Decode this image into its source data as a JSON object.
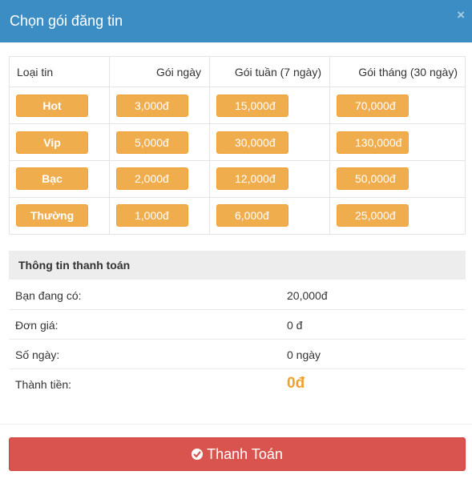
{
  "dialog": {
    "title": "Chọn gói đăng tin",
    "close_icon": "×"
  },
  "pricing": {
    "headers": [
      "Loại tin",
      "Gói ngày",
      "Gói tuần (7 ngày)",
      "Gói tháng (30 ngày)"
    ],
    "rows": [
      {
        "type": "Hot",
        "day": "3,000đ",
        "week": "15,000đ",
        "month": "70,000đ"
      },
      {
        "type": "Vip",
        "day": "5,000đ",
        "week": "30,000đ",
        "month": "130,000đ"
      },
      {
        "type": "Bạc",
        "day": "2,000đ",
        "week": "12,000đ",
        "month": "50,000đ"
      },
      {
        "type": "Thường",
        "day": "1,000đ",
        "week": "6,000đ",
        "month": "25,000đ"
      }
    ]
  },
  "payment_info": {
    "title": "Thông tin thanh toán",
    "rows": [
      {
        "label": "Bạn đang có:",
        "value": "20,000đ"
      },
      {
        "label": "Đơn giá:",
        "value": "0 đ"
      },
      {
        "label": "Số ngày:",
        "value": "0 ngày"
      },
      {
        "label": "Thành tiền:",
        "value": "0đ"
      }
    ]
  },
  "pay_button": {
    "label": "Thanh Toán",
    "icon": "check-circle-icon"
  },
  "colors": {
    "header": "#3c8dc4",
    "package_button": "#f0ad4e",
    "pay_button": "#d9534f",
    "total": "#f0a030"
  }
}
